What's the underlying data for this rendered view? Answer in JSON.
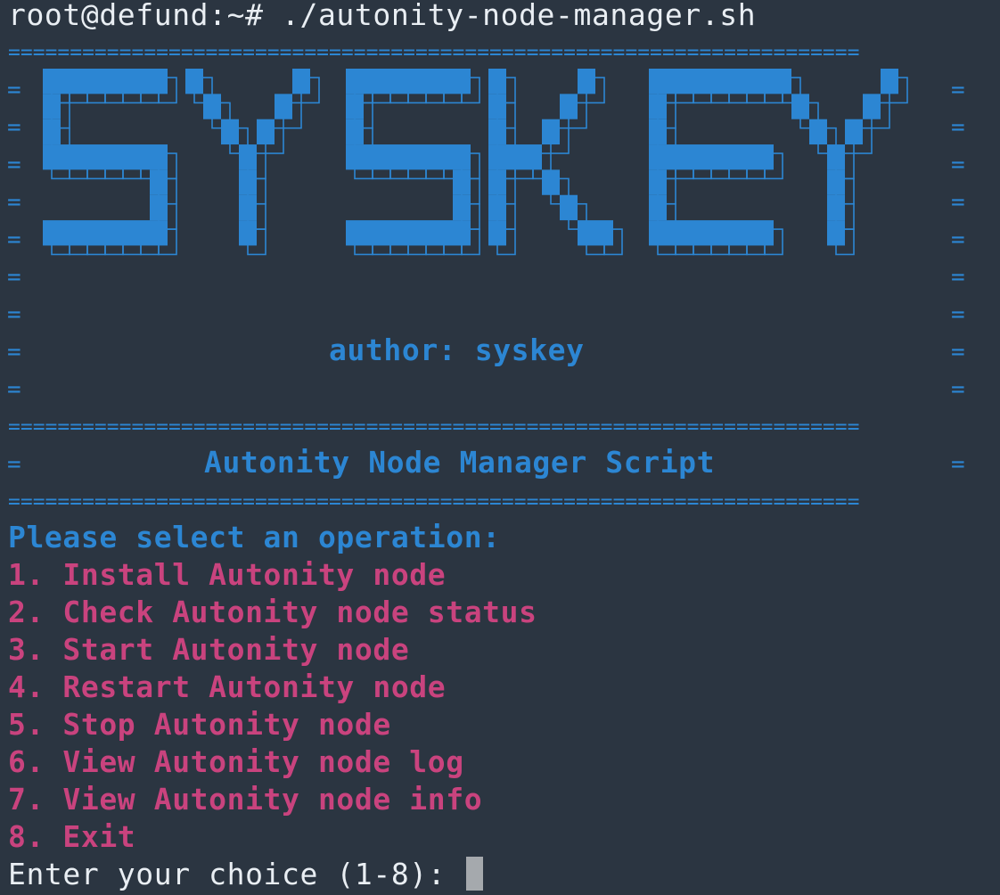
{
  "prompt": {
    "text": "root@defund:~# ./autonity-node-manager.sh"
  },
  "banner": {
    "rule": "=====================================================================",
    "edge": "=",
    "logo_text": "SYSKEY",
    "author": "author: syskey",
    "title": "Autonity Node Manager Script"
  },
  "menu": {
    "heading": "Please select an operation:",
    "items": [
      "1. Install Autonity node",
      "2. Check Autonity node status",
      "3. Start Autonity node",
      "4. Restart Autonity node",
      "5. Stop Autonity node",
      "6. View Autonity node log",
      "7. View Autonity node info",
      "8. Exit"
    ]
  },
  "input": {
    "prompt": "Enter your choice (1-8): "
  },
  "colors": {
    "background": "#2b3541",
    "text": "#e9eef3",
    "accent_blue": "#2c86d3",
    "menu_pink": "#c9437e",
    "cursor": "#a5a9ad"
  }
}
